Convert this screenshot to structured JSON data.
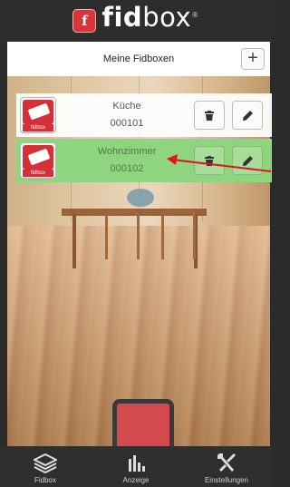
{
  "brand": {
    "badge_letter": "f",
    "name_bold": "fid",
    "name_light": "box",
    "reg_mark": "®"
  },
  "header": {
    "title": "Meine Fidboxen",
    "add_label": "+"
  },
  "fidboxes": [
    {
      "name": "Küche",
      "id": "000101",
      "icon_label": "fidbox",
      "selected": false
    },
    {
      "name": "Wohnzimmer",
      "id": "000102",
      "icon_label": "fidbox",
      "selected": true
    }
  ],
  "tabs": [
    {
      "label": "Fidbox",
      "icon": "layers-icon"
    },
    {
      "label": "Anzeige",
      "icon": "bar-chart-icon"
    },
    {
      "label": "Einstellungen",
      "icon": "tools-icon"
    }
  ],
  "colors": {
    "selected_row": "#8fd47f",
    "brand_red": "#d8343a",
    "arrow": "#e0141e"
  }
}
